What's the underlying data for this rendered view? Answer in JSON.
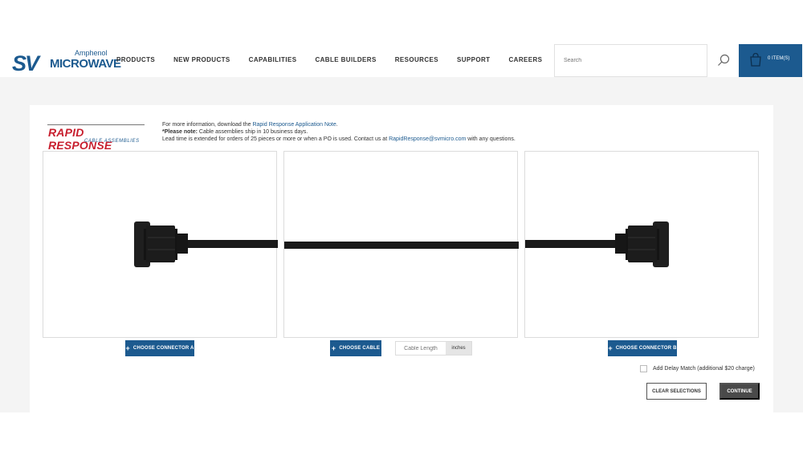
{
  "header": {
    "logo": {
      "brand": "SV",
      "company": "Amphenol",
      "product": "MICROWAVE"
    },
    "nav": [
      "PRODUCTS",
      "NEW PRODUCTS",
      "CAPABILITIES",
      "CABLE BUILDERS",
      "RESOURCES",
      "SUPPORT",
      "CAREERS"
    ],
    "search_placeholder": "Search",
    "cart_label": "0 ITEM(S)"
  },
  "builder": {
    "rr_logo_main": "RAPID RESPONSE",
    "rr_logo_sub": "CABLE ASSEMBLIES",
    "info_line1_prefix": "For more information, download the ",
    "info_line1_link": "Rapid Response Application Note",
    "info_line1_suffix": ".",
    "info_line2_bold": "*Please note:",
    "info_line2_rest": " Cable assemblies ship in 10 business days.",
    "info_line3_prefix": "Lead time is extended for orders of 25 pieces or more or when a PO is used. Contact us at ",
    "info_line3_email": "RapidResponse@svmicro.com",
    "info_line3_suffix": " with any questions.",
    "choose_connector_a": "CHOOSE CONNECTOR A",
    "choose_cable": "CHOOSE CABLE",
    "cable_length_placeholder": "Cable Length",
    "length_unit": "inches",
    "choose_connector_b": "CHOOSE CONNECTOR B",
    "delay_match_label": "Add Delay Match (additional $20 charge)",
    "clear_selections": "CLEAR SELECTIONS",
    "continue": "CONTINUE"
  },
  "colors": {
    "brand_blue": "#1c5a8f",
    "brand_red": "#c8202f",
    "dark_button": "#4a4a4a"
  }
}
